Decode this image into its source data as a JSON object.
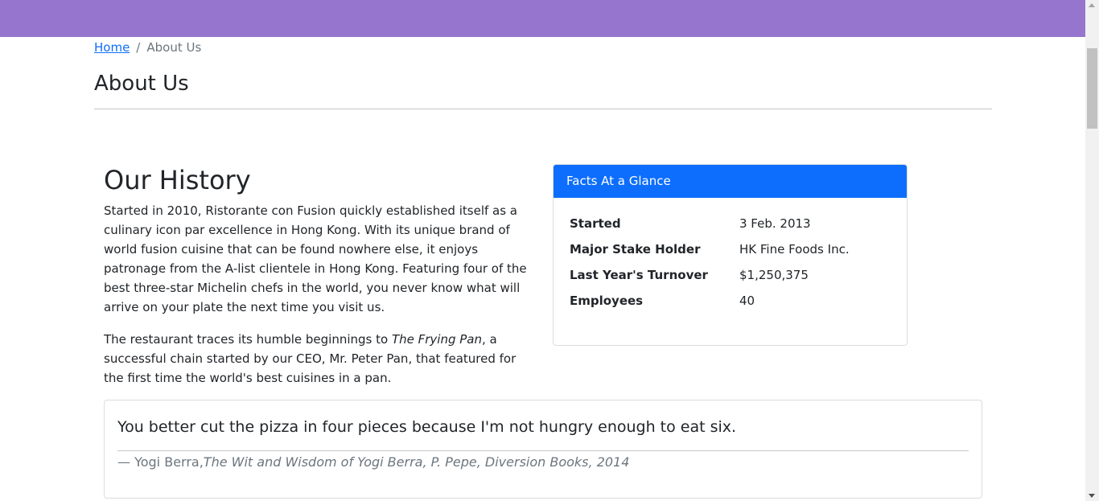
{
  "colors": {
    "topbar": "#9575cd",
    "link": "#0d6efd",
    "card_header": "#0d6efd"
  },
  "breadcrumb": {
    "home_label": "Home",
    "separator": "/",
    "current_label": "About Us"
  },
  "page_title": "About Us",
  "history": {
    "heading": "Our History",
    "paragraph1": "Started in 2010, Ristorante con Fusion quickly established itself as a culinary icon par excellence in Hong Kong. With its unique brand of world fusion cuisine that can be found nowhere else, it enjoys patronage from the A-list clientele in Hong Kong. Featuring four of the best three-star Michelin chefs in the world, you never know what will arrive on your plate the next time you visit us.",
    "paragraph2_before": "The restaurant traces its humble beginnings to ",
    "paragraph2_italic": "The Frying Pan",
    "paragraph2_after": ", a successful chain started by our CEO, Mr. Peter Pan, that featured for the first time the world's best cuisines in a pan."
  },
  "facts": {
    "header": "Facts At a Glance",
    "rows": [
      {
        "label": "Started",
        "value": "3 Feb. 2013"
      },
      {
        "label": "Major Stake Holder",
        "value": "HK Fine Foods Inc."
      },
      {
        "label": "Last Year's Turnover",
        "value": "$1,250,375"
      },
      {
        "label": "Employees",
        "value": "40"
      }
    ]
  },
  "quote": {
    "text": "You better cut the pizza in four pieces because I'm not hungry enough to eat six.",
    "author": "— Yogi Berra,",
    "source": "The Wit and Wisdom of Yogi Berra, P. Pepe, Diversion Books, 2014"
  }
}
